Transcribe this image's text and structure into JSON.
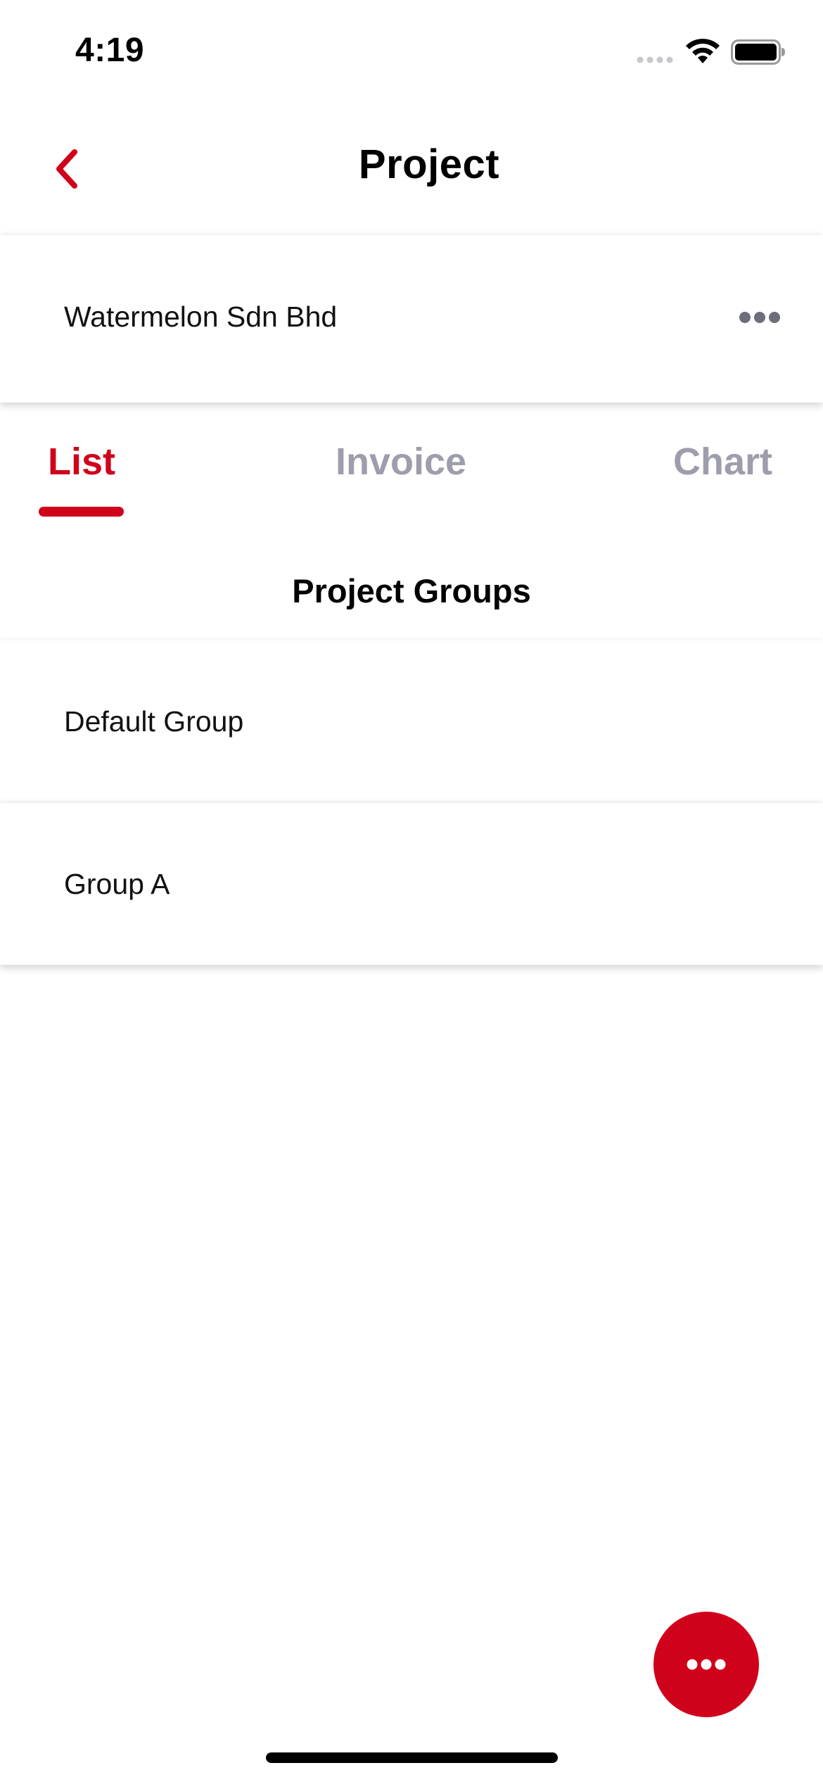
{
  "status_bar": {
    "time": "4:19"
  },
  "header": {
    "title": "Project",
    "back_icon": "chevron-left-icon"
  },
  "company": {
    "name": "Watermelon Sdn Bhd",
    "more_icon": "ellipsis-icon"
  },
  "tabs": [
    {
      "label": "List",
      "active": true
    },
    {
      "label": "Invoice",
      "active": false
    },
    {
      "label": "Chart",
      "active": false
    }
  ],
  "section": {
    "heading": "Project Groups"
  },
  "groups": [
    {
      "label": "Default Group"
    },
    {
      "label": "Group A"
    }
  ],
  "fab": {
    "icon": "ellipsis-icon"
  },
  "colors": {
    "accent": "#d0021b",
    "inactive_tab": "#9d9dac",
    "more_icon": "#6c6f7a"
  }
}
